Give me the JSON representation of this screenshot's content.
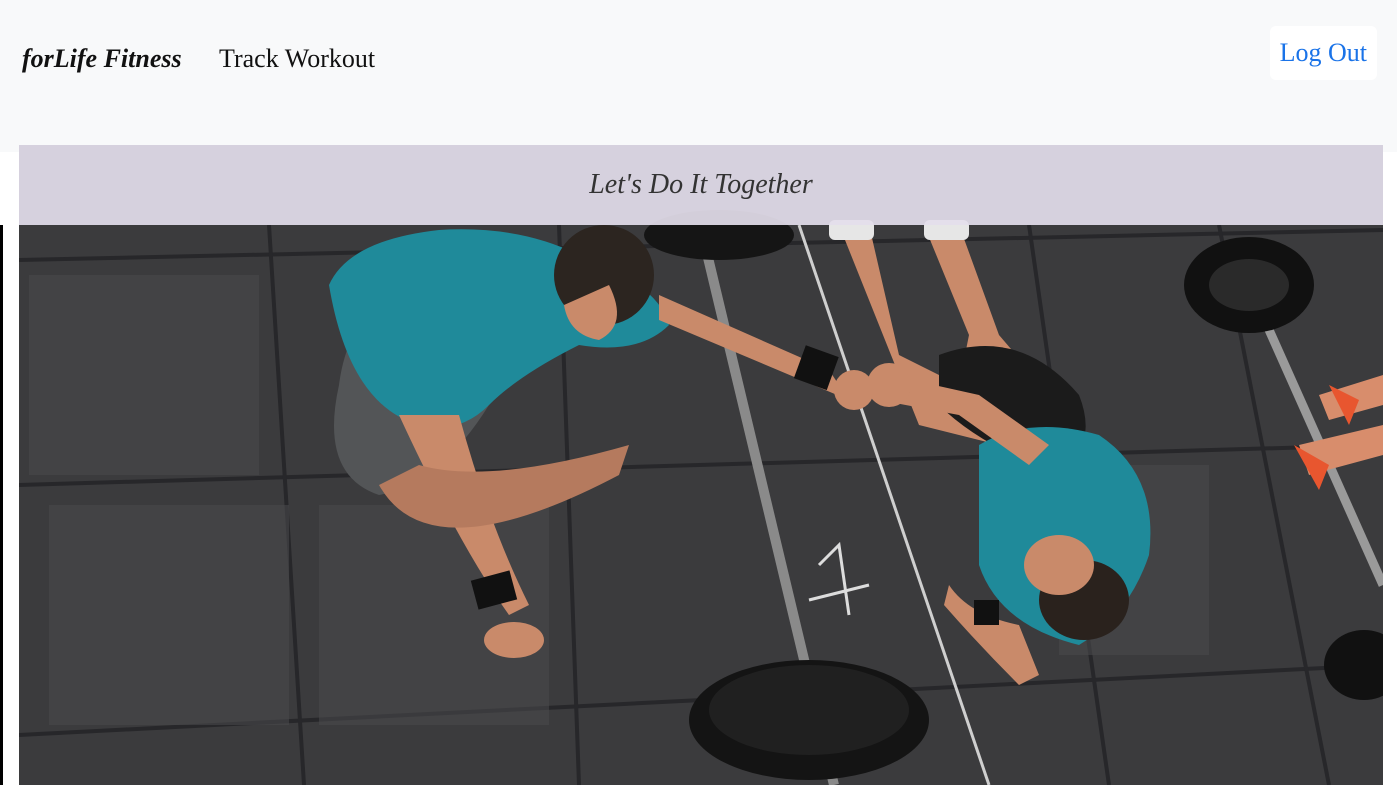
{
  "navbar": {
    "brand": "forLife Fitness",
    "links": [
      {
        "label": "Track Workout"
      }
    ],
    "logout_label": "Log Out"
  },
  "hero": {
    "tagline": "Let's Do It Together",
    "image_description_icon": "gym-photo"
  },
  "colors": {
    "navbar_bg": "#f8f9fa",
    "banner_bg": "#e4deec",
    "link_blue": "#1a73e8",
    "floor": "#3a3a3c",
    "shirt_teal": "#1f8a9a"
  }
}
